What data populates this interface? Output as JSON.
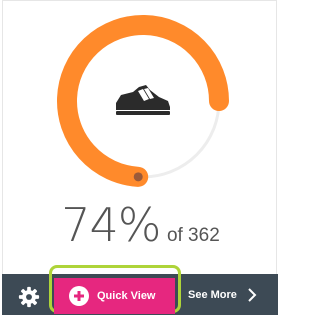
{
  "card": {
    "percent_value": 0.74,
    "percent_text": "74%",
    "of_text": "of 362",
    "icon": "sneaker-icon",
    "colors": {
      "progress": "#ff8a2b",
      "track": "#ededed",
      "knob": "#9a5a3a"
    }
  },
  "toolbar": {
    "settings_icon": "gear-icon",
    "quick_view_label": "Quick View",
    "quick_view_icon": "plus-circle-icon",
    "see_more_label": "See More",
    "see_more_icon": "chevron-right-icon",
    "colors": {
      "bar": "#3d4a55",
      "quick_view": "#e6277f",
      "highlight": "#aed439"
    }
  }
}
